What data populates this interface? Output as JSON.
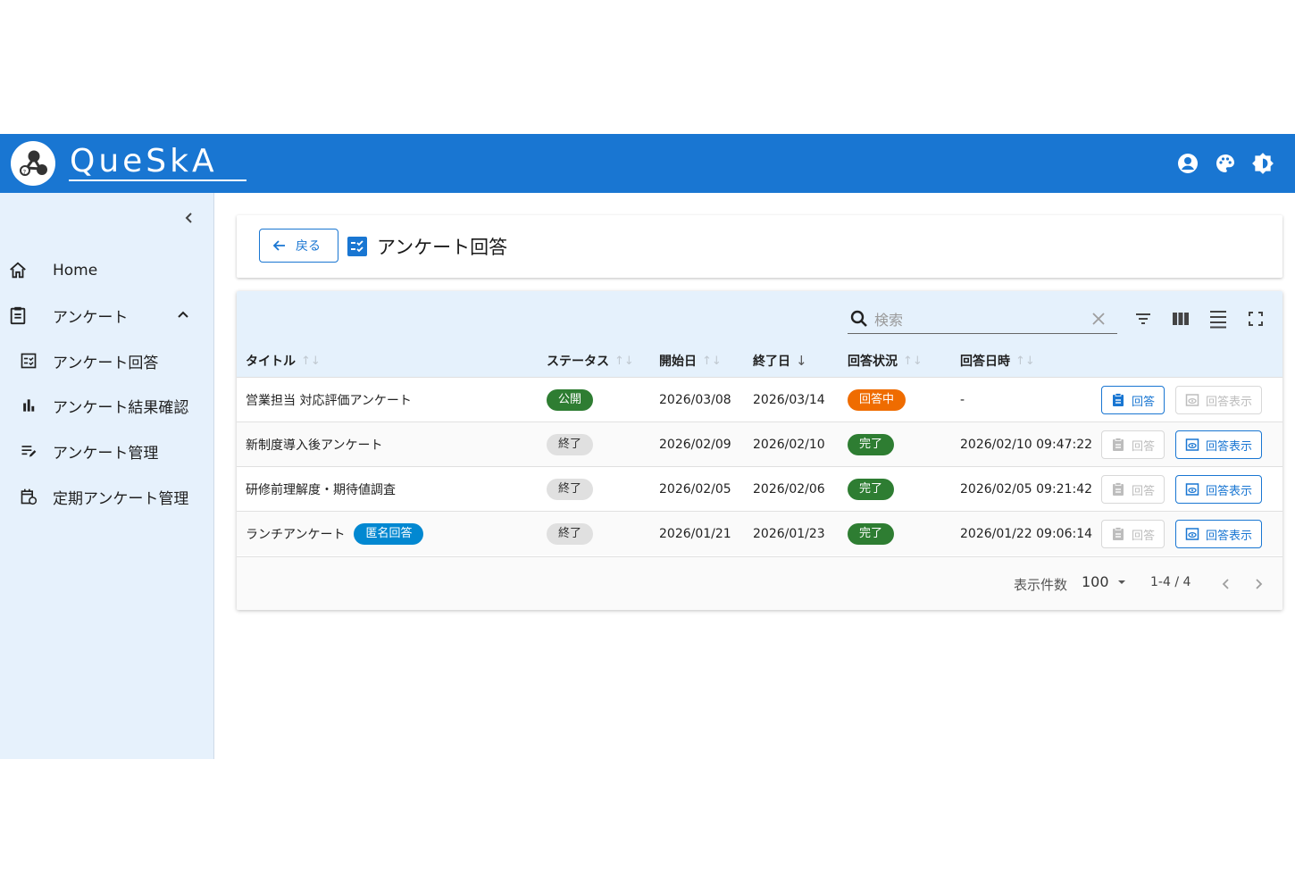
{
  "header": {
    "logo_text": "QueSkA",
    "icons": [
      "account-icon",
      "palette-icon",
      "brightness-icon"
    ]
  },
  "sidebar": {
    "items": [
      {
        "label": "Home",
        "icon": "home-icon"
      },
      {
        "label": "アンケート",
        "icon": "clipboard-icon",
        "expanded": true
      },
      {
        "label": "アンケート回答",
        "icon": "checklist-icon"
      },
      {
        "label": "アンケート結果確認",
        "icon": "bar-chart-icon"
      },
      {
        "label": "アンケート管理",
        "icon": "edit-list-icon"
      },
      {
        "label": "定期アンケート管理",
        "icon": "calendar-refresh-icon"
      }
    ]
  },
  "page": {
    "back_label": "戻る",
    "title": "アンケート回答"
  },
  "table": {
    "search_placeholder": "検索",
    "columns": [
      "タイトル",
      "ステータス",
      "開始日",
      "終了日",
      "回答状況",
      "回答日時"
    ],
    "rows": [
      {
        "title": "営業担当 対応評価アンケート",
        "tag": "",
        "status": "公開",
        "start": "2026/03/08",
        "end": "2026/03/14",
        "answer_status": "回答中",
        "answered_at": "-",
        "answer_label": "回答",
        "view_label": "回答表示",
        "answer_enabled": true,
        "view_enabled": false
      },
      {
        "title": "新制度導入後アンケート",
        "tag": "",
        "status": "終了",
        "start": "2026/02/09",
        "end": "2026/02/10",
        "answer_status": "完了",
        "answered_at": "2026/02/10 09:47:22",
        "answer_label": "回答",
        "view_label": "回答表示",
        "answer_enabled": false,
        "view_enabled": true
      },
      {
        "title": "研修前理解度・期待値調査",
        "tag": "",
        "status": "終了",
        "start": "2026/02/05",
        "end": "2026/02/06",
        "answer_status": "完了",
        "answered_at": "2026/02/05 09:21:42",
        "answer_label": "回答",
        "view_label": "回答表示",
        "answer_enabled": false,
        "view_enabled": true
      },
      {
        "title": "ランチアンケート",
        "tag": "匿名回答",
        "status": "終了",
        "start": "2026/01/21",
        "end": "2026/01/23",
        "answer_status": "完了",
        "answered_at": "2026/01/22 09:06:14",
        "answer_label": "回答",
        "view_label": "回答表示",
        "answer_enabled": false,
        "view_enabled": true
      }
    ],
    "footer": {
      "rows_per_page_label": "表示件数",
      "rows_per_page": "100",
      "page_info": "1-4 / 4"
    }
  },
  "colors": {
    "primary": "#1976d2",
    "sidebar_bg": "#e6f1fc",
    "chip_green": "#2e7d32",
    "chip_orange": "#ef6c00",
    "chip_grey": "#e0e0e0",
    "chip_blue": "#0288d1"
  }
}
